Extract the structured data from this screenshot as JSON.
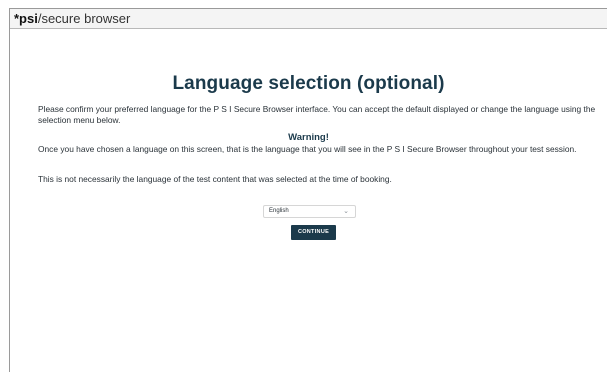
{
  "window": {
    "logo": "*psi",
    "path": " /secure browser"
  },
  "page": {
    "heading": "Language selection (optional)",
    "intro": "Please confirm your preferred language for the P S I Secure Browser interface. You can accept the default displayed or change the language using the selection menu below.",
    "warning_title": "Warning!",
    "warning_text": "Once you have chosen a language on this screen, that is the language that you will see in the P S I Secure Browser throughout your test session.",
    "note": "This is not necessarily the language of the test content that was selected at the time of booking."
  },
  "language_select": {
    "selected": "English",
    "icon": "chevron-down-icon"
  },
  "continue_button": {
    "label": "CONTINUE"
  },
  "colors": {
    "accent": "#1b3a4b",
    "button_text": "#ffffff"
  }
}
